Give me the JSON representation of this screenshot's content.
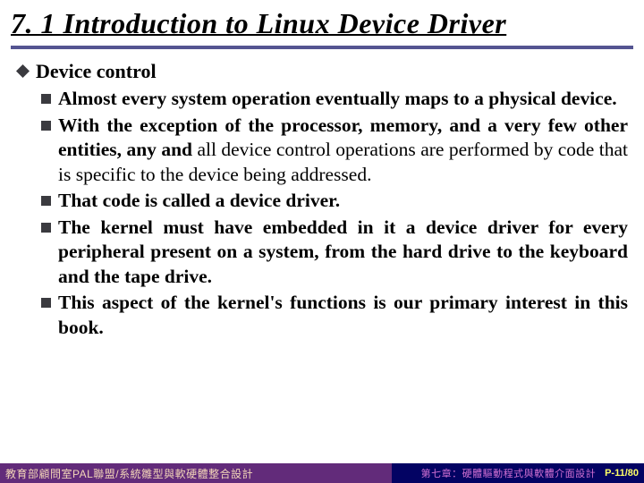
{
  "title": "7. 1 Introduction to Linux Device Driver",
  "section": {
    "heading": "Device control",
    "bullets": [
      {
        "bold": "Almost every system operation eventually maps to a physical device.",
        "tail": ""
      },
      {
        "bold": "With the exception of the processor, memory, and a very few other entities, any and ",
        "tail": "all device control operations are performed by code that is specific to the device being addressed."
      },
      {
        "bold": "That code is called a device driver.",
        "tail": ""
      },
      {
        "bold": "The kernel must have embedded in it a device driver for every peripheral present on a system, from the hard drive to the keyboard and the tape drive.",
        "tail": ""
      },
      {
        "bold": "This aspect of the kernel's functions is our primary interest in this book.",
        "tail": ""
      }
    ]
  },
  "footer": {
    "left": "教育部顧問室PAL聯盟/系統雛型與軟硬體整合設計",
    "chapter": "第七章：硬體驅動程式與軟體介面設計",
    "page": "P-11/80"
  }
}
